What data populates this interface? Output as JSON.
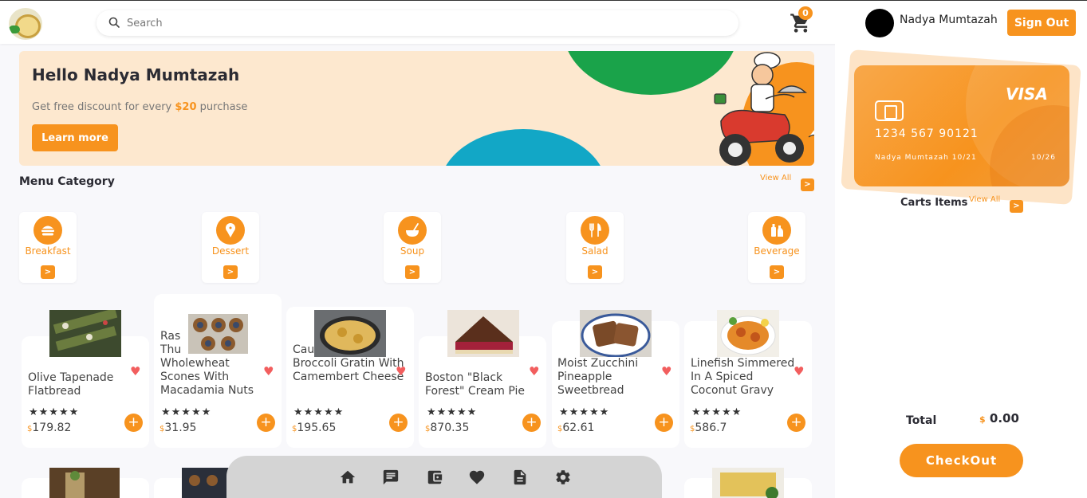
{
  "header": {
    "search_placeholder": "Search",
    "cart_count": "0",
    "user_name": "Nadya Mumtazah",
    "signout_label": "Sign Out"
  },
  "banner": {
    "greeting": "Hello Nadya Mumtazah",
    "promo_prefix": "Get free discount for every ",
    "promo_amount": "$20",
    "promo_suffix": " purchase",
    "cta_label": "Learn more"
  },
  "menu": {
    "title": "Menu Category",
    "view_all": "View All",
    "categories": [
      {
        "label": "Breakfast",
        "icon": "burger-icon"
      },
      {
        "label": "Dessert",
        "icon": "ice-cream-icon"
      },
      {
        "label": "Soup",
        "icon": "soup-icon"
      },
      {
        "label": "Salad",
        "icon": "fork-knife-icon"
      },
      {
        "label": "Beverage",
        "icon": "beverage-icon"
      }
    ]
  },
  "products": [
    {
      "name": "Olive Tapenade Flatbread",
      "rating": "★★★★★",
      "currency": "$",
      "price": "179.82"
    },
    {
      "name_overlap": "Ras Thu",
      "name": "Wholewheat Scones With Macadamia Nuts",
      "rating": "★★★★★",
      "currency": "$",
      "price": "31.95"
    },
    {
      "name_overlap": "Cau",
      "name": "Broccoli Gratin With Camembert Cheese",
      "rating": "★★★★★",
      "currency": "$",
      "price": "195.65"
    },
    {
      "name": "Boston \"Black Forest\" Cream Pie",
      "rating": "★★★★★",
      "currency": "$",
      "price": "870.35"
    },
    {
      "name": "Moist Zucchini Pineapple Sweetbread",
      "rating": "★★★★★",
      "currency": "$",
      "price": "62.61"
    },
    {
      "name": "Linefish Simmered In A Spiced Coconut Gravy",
      "rating": "★★★★★",
      "currency": "$",
      "price": "586.7"
    }
  ],
  "payment_card": {
    "brand": "VISA",
    "number": "1234 567 90121",
    "holder": "Nadya Mumtazah 10/21",
    "expiry": "10/26"
  },
  "cart": {
    "title": "Carts Items",
    "view_all": "View All",
    "total_label": "Total",
    "total_currency": "$",
    "total_value": "0.00",
    "checkout_label": "CheckOut"
  },
  "colors": {
    "accent": "#f7931e",
    "heart": "#f25e5e"
  }
}
